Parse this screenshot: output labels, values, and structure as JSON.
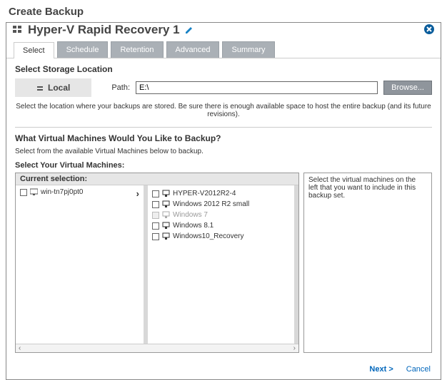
{
  "page_title": "Create Backup",
  "backup_name": "Hyper-V Rapid Recovery 1",
  "tabs": [
    "Select",
    "Schedule",
    "Retention",
    "Advanced",
    "Summary"
  ],
  "active_tab": 0,
  "storage": {
    "heading": "Select Storage Location",
    "local_label": "Local",
    "path_label": "Path:",
    "path_value": "E:\\",
    "browse_label": "Browse...",
    "hint": "Select the location where your backups are stored. Be sure there is enough available space to host the entire backup (and its future revisions)."
  },
  "vm_section": {
    "heading": "What Virtual Machines Would You Like to Backup?",
    "subtext": "Select from the available Virtual Machines below to backup.",
    "select_label": "Select Your Virtual Machines:",
    "tree_header": "Current selection:",
    "host": "win-tn7pj0pt0",
    "vms": [
      {
        "name": "HYPER-V2012R2-4",
        "enabled": true
      },
      {
        "name": "Windows 2012 R2 small",
        "enabled": true
      },
      {
        "name": "Windows 7",
        "enabled": false
      },
      {
        "name": "Windows 8.1",
        "enabled": true
      },
      {
        "name": "Windows10_Recovery",
        "enabled": true
      }
    ],
    "side_text": "Select the virtual machines on the left that you want to include in this backup set."
  },
  "footer": {
    "next": "Next >",
    "cancel": "Cancel"
  }
}
